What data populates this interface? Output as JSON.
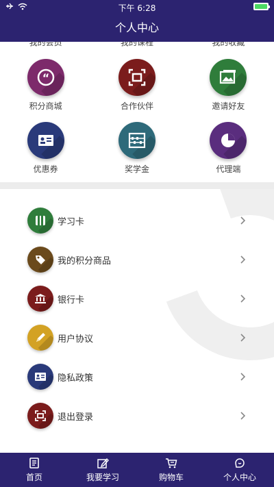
{
  "status_bar": {
    "time": "下午 6:28"
  },
  "header": {
    "title": "个人中心"
  },
  "top_row_cut": [
    "我的会员",
    "我的课程",
    "我的收藏"
  ],
  "grid": [
    {
      "label": "积分商城",
      "icon": "quote-icon",
      "color": "#7d2a6b"
    },
    {
      "label": "合作伙伴",
      "icon": "frame-icon",
      "color": "#7b1c1c"
    },
    {
      "label": "邀请好友",
      "icon": "image-icon",
      "color": "#2f7d3b"
    },
    {
      "label": "优惠券",
      "icon": "id-card-icon",
      "color": "#2a3a7a"
    },
    {
      "label": "奖学金",
      "icon": "abacus-icon",
      "color": "#2e6a7a"
    },
    {
      "label": "代理端",
      "icon": "pie-chart-icon",
      "color": "#5a2d7e"
    }
  ],
  "list": [
    {
      "label": "学习卡",
      "icon": "card-icon",
      "color": "#2f7d3b"
    },
    {
      "label": "我的积分商品",
      "icon": "tag-icon",
      "color": "#6b4a1c"
    },
    {
      "label": "银行卡",
      "icon": "bank-icon",
      "color": "#7b1c1c"
    },
    {
      "label": "用户协议",
      "icon": "pen-icon",
      "color": "#d3a224"
    },
    {
      "label": "隐私政策",
      "icon": "id-card-icon",
      "color": "#2a3a7a"
    },
    {
      "label": "退出登录",
      "icon": "frame-icon",
      "color": "#7b1c1c"
    }
  ],
  "tabs": [
    {
      "label": "首页",
      "icon": "home-doc-icon"
    },
    {
      "label": "我要学习",
      "icon": "edit-icon"
    },
    {
      "label": "购物车",
      "icon": "cart-icon"
    },
    {
      "label": "个人中心",
      "icon": "chat-icon"
    }
  ],
  "colors": {
    "brand": "#2c2370"
  }
}
